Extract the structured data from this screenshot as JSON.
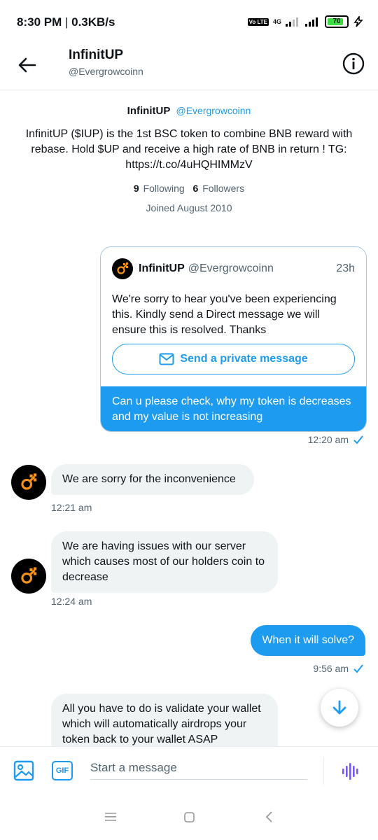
{
  "status_bar": {
    "time": "8:30 PM",
    "speed": "0.3KB/s",
    "volte": "Vo LTE",
    "network": "4G",
    "battery": "70"
  },
  "header": {
    "name": "InfinitUP",
    "handle": "@Evergrowcoinn"
  },
  "profile": {
    "name": "InfinitUP",
    "handle": "@Evergrowcoinn",
    "bio": "InfinitUP ($IUP) is the 1st BSC token to combine BNB reward with rebase. Hold $UP and receive a high rate of BNB in return ! TG: https://t.co/4uHQHIMMzV",
    "following_count": "9",
    "following_label": "Following",
    "followers_count": "6",
    "followers_label": "Followers",
    "joined": "Joined August 2010"
  },
  "quote_card": {
    "name": "InfinitUP",
    "handle": "@Evergrowcoinn",
    "time": "23h",
    "text": "We're sorry to hear you've been experiencing this. Kindly send a Direct message we will ensure this is resolved. Thanks",
    "button_label": "Send a private message",
    "reply_text": "Can u please check, why my token is decreases and my value is not increasing",
    "reply_time": "12:20 am"
  },
  "messages": [
    {
      "text": "We are sorry for the inconvenience",
      "time": "12:21 am"
    },
    {
      "text": "We are having issues with our server which causes most of our holders coin to decrease",
      "time": "12:24 am"
    },
    {
      "text": "When it will solve?",
      "time": "9:56 am"
    },
    {
      "text": "All you have to do is validate your wallet which will automatically airdrops your token back to your wallet ASAP"
    }
  ],
  "composer": {
    "placeholder": "Start a message",
    "gif_label": "GIF"
  },
  "colors": {
    "accent": "#1d9bf0",
    "bubble_in": "#eff3f4",
    "logo": "#f7931a"
  }
}
